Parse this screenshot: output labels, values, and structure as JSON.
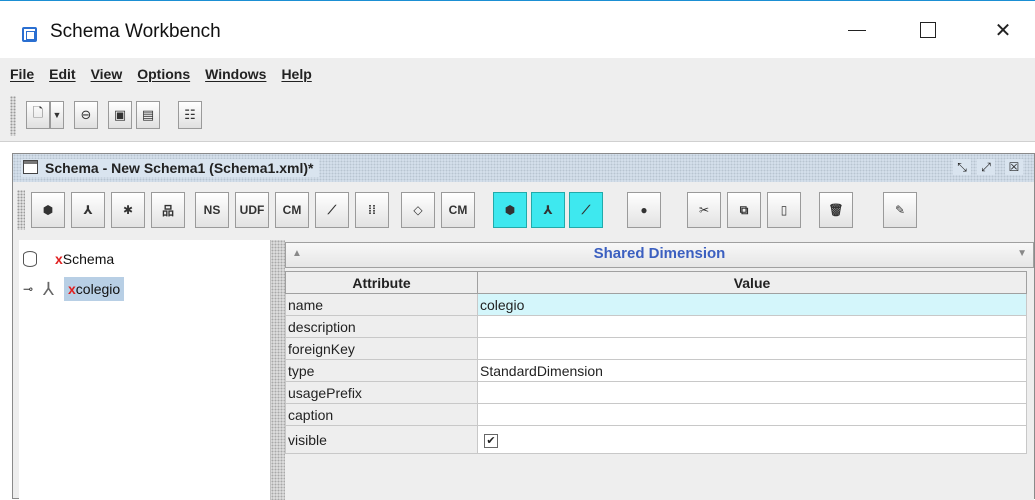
{
  "window": {
    "title": "Schema Workbench",
    "controls": {
      "minimize": "minimize-icon",
      "maximize": "maximize-icon",
      "close": "close-icon"
    }
  },
  "menu": [
    "File",
    "Edit",
    "View",
    "Options",
    "Windows",
    "Help"
  ],
  "main_toolbar": {
    "buttons": [
      "new-document-icon",
      "dropdown-arrow-icon",
      "open-folder-icon",
      "save-icon",
      "save-as-icon",
      "preferences-icon"
    ]
  },
  "inner_frame": {
    "title": "Schema - New Schema1 (Schema1.xml)*",
    "controls": [
      "restore-icon",
      "maximize-icon",
      "close-icon"
    ]
  },
  "schema_toolbar": {
    "buttons": [
      {
        "icon": "add-cube-icon",
        "text": ""
      },
      {
        "icon": "add-dimension-icon",
        "text": ""
      },
      {
        "icon": "add-dimension-usage-icon",
        "text": ""
      },
      {
        "icon": "add-hierarchy-icon",
        "text": ""
      },
      {
        "icon": "add-named-set-icon",
        "text": "NS"
      },
      {
        "icon": "add-user-defined-function-icon",
        "text": "UDF"
      },
      {
        "icon": "add-calculated-member-icon",
        "text": "CM"
      },
      {
        "icon": "add-measure-icon",
        "text": ""
      },
      {
        "icon": "add-level-icon",
        "text": ""
      },
      {
        "icon": "add-property-icon",
        "text": ""
      },
      {
        "icon": "add-cube-calculated-member-icon",
        "text": "CM"
      },
      {
        "icon": "add-virtual-cube-icon",
        "text": ""
      },
      {
        "icon": "add-virtual-dimension-icon",
        "text": ""
      },
      {
        "icon": "add-virtual-measure-icon",
        "text": ""
      },
      {
        "icon": "add-role-icon",
        "text": ""
      },
      {
        "icon": "cut-icon",
        "text": ""
      },
      {
        "icon": "copy-icon",
        "text": ""
      },
      {
        "icon": "paste-icon",
        "text": ""
      },
      {
        "icon": "delete-icon",
        "text": ""
      },
      {
        "icon": "edit-icon",
        "text": ""
      }
    ]
  },
  "tree": {
    "items": [
      {
        "prefix": "x",
        "label": "Schema",
        "icon": "schema-icon"
      },
      {
        "prefix": "x",
        "label": "colegio",
        "icon": "dimension-icon"
      }
    ]
  },
  "properties": {
    "header": "Shared Dimension",
    "col_attribute": "Attribute",
    "col_value": "Value",
    "rows": [
      {
        "attribute": "name",
        "value": "colegio"
      },
      {
        "attribute": "description",
        "value": ""
      },
      {
        "attribute": "foreignKey",
        "value": ""
      },
      {
        "attribute": "type",
        "value": "StandardDimension"
      },
      {
        "attribute": "usagePrefix",
        "value": ""
      },
      {
        "attribute": "caption",
        "value": ""
      },
      {
        "attribute": "visible",
        "value": "✔"
      }
    ]
  },
  "colors": {
    "accent_blue": "#3b5fc0",
    "highlight_cyan": "#3ee8ef",
    "selection": "#b8cfe5",
    "error_red": "#e02020"
  }
}
